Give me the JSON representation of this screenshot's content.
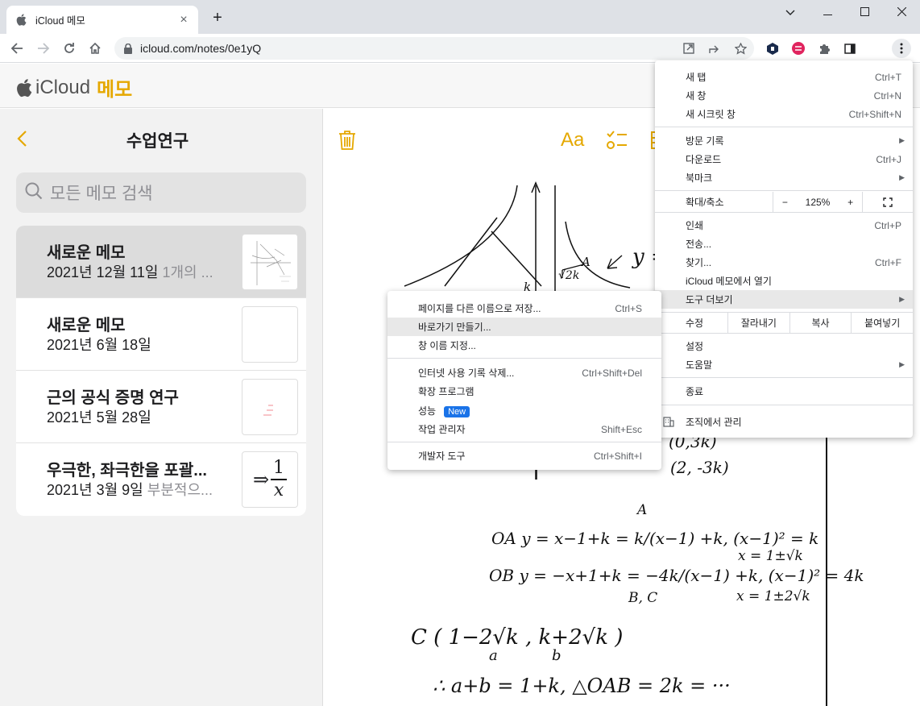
{
  "browser": {
    "tab_title": "iCloud 메모",
    "url": "icloud.com/notes/0e1yQ"
  },
  "app": {
    "brand_icloud": "iCloud",
    "brand_notes": "메모"
  },
  "sidebar": {
    "folder_title": "수업연구",
    "search_placeholder": "모든 메모 검색",
    "notes": [
      {
        "title": "새로운 메모",
        "date": "2021년 12월 11일",
        "preview": "1개의 ..."
      },
      {
        "title": "새로운 메모",
        "date": "2021년 6월 18일",
        "preview": ""
      },
      {
        "title": "근의 공식 증명 연구",
        "date": "2021년 5월 28일",
        "preview": ""
      },
      {
        "title": "우극한, 좌극한을 포괄...",
        "date": "2021년 3월 9일",
        "preview": "부분적으..."
      }
    ],
    "thumb4_math": "⇒",
    "thumb4_num": "1",
    "thumb4_den": "x"
  },
  "editor": {
    "font_button": "Aa",
    "handwriting": {
      "l1": "y =",
      "l2": "(0,3k)",
      "l3": "(2, -3k)",
      "l4": "A",
      "l5": "OA   y = x−1+k  =  k/(x−1) +k,   (x−1)² = k",
      "l6": "x = 1±√k",
      "l7": "OB   y = −x+1+k  =  −4k/(x−1) +k,   (x−1)² = 4k",
      "l8": "x = 1±2√k",
      "l9": "B, C",
      "l10": "C ( 1−2√k ,   k+2√k )",
      "l11": "a",
      "l12": "b",
      "l13": "∴  a+b = 1+k,   △OAB = 2k  =  ···",
      "l14": "k",
      "l15": "√2k",
      "l16": "A"
    }
  },
  "chrome_menu": {
    "new_tab": "새 탭",
    "new_tab_sc": "Ctrl+T",
    "new_window": "새 창",
    "new_window_sc": "Ctrl+N",
    "incognito": "새 시크릿 창",
    "incognito_sc": "Ctrl+Shift+N",
    "history": "방문 기록",
    "downloads": "다운로드",
    "downloads_sc": "Ctrl+J",
    "bookmarks": "북마크",
    "zoom_label": "확대/축소",
    "zoom_minus": "−",
    "zoom_value": "125%",
    "zoom_plus": "+",
    "print": "인쇄",
    "print_sc": "Ctrl+P",
    "cast": "전송...",
    "find": "찾기...",
    "find_sc": "Ctrl+F",
    "open_in_app": "iCloud 메모에서 열기",
    "more_tools": "도구 더보기",
    "edit_label": "수정",
    "cut": "잘라내기",
    "copy": "복사",
    "paste": "붙여넣기",
    "settings": "설정",
    "help": "도움말",
    "exit": "종료",
    "managed": "조직에서 관리"
  },
  "submenu": {
    "save_as": "페이지를 다른 이름으로 저장...",
    "save_as_sc": "Ctrl+S",
    "create_shortcut": "바로가기 만들기...",
    "name_window": "창 이름 지정...",
    "clear_data": "인터넷 사용 기록 삭제...",
    "clear_data_sc": "Ctrl+Shift+Del",
    "extensions": "확장 프로그램",
    "performance": "성능",
    "new_badge": "New",
    "task_manager": "작업 관리자",
    "task_manager_sc": "Shift+Esc",
    "dev_tools": "개발자 도구",
    "dev_tools_sc": "Ctrl+Shift+I"
  }
}
